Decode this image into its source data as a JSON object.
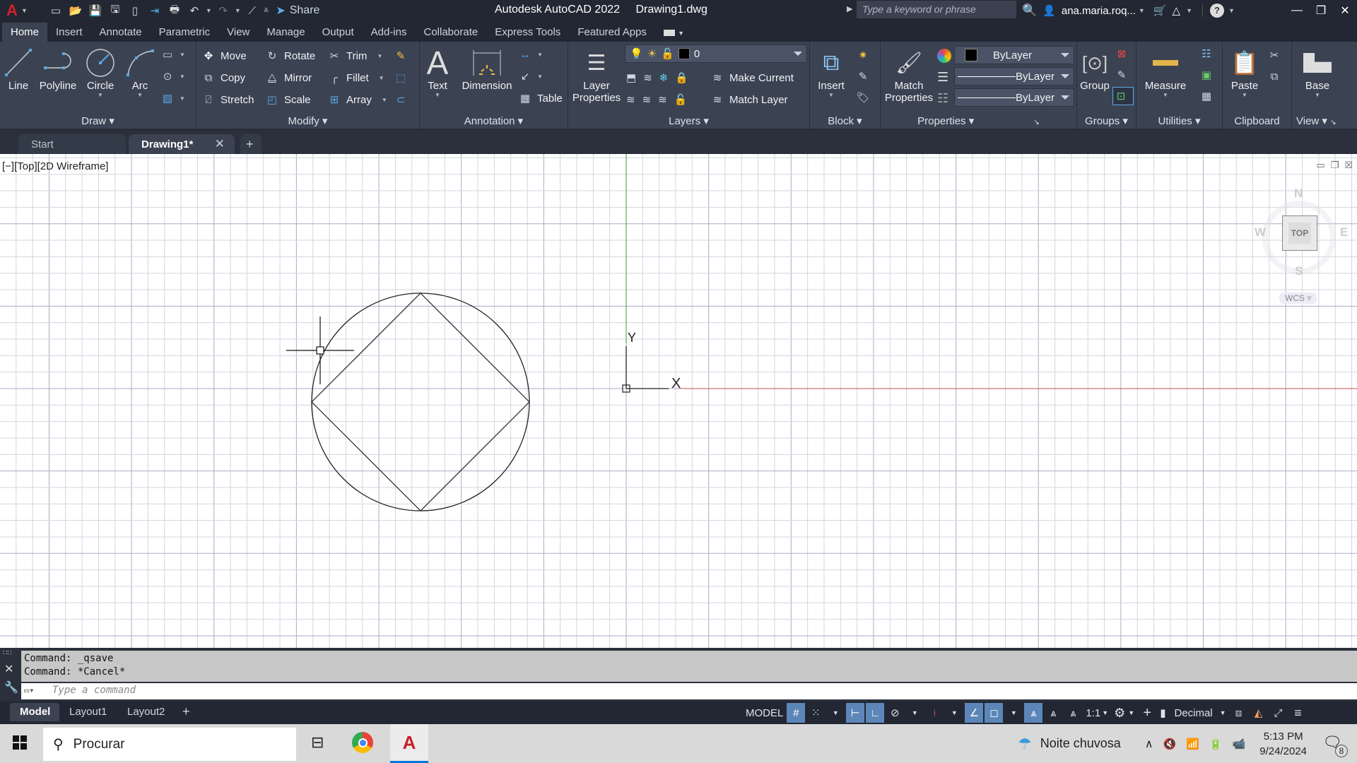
{
  "titlebar": {
    "app_icon": "autocad-logo-icon",
    "quick_access": [
      "new-icon",
      "open-icon",
      "save-icon",
      "save-as-icon",
      "open-web-mobile-icon",
      "save-web-mobile-icon",
      "plot-icon",
      "undo-icon",
      "redo-icon",
      "workspace-line-icon",
      "customize-qat-icon"
    ],
    "share_label": "Share",
    "app_title": "Autodesk AutoCAD 2022",
    "file_name": "Drawing1.dwg",
    "search_placeholder": "Type a keyword or phrase",
    "user_name": "ana.maria.roq...",
    "help_icon": "?"
  },
  "menu_tabs": [
    "Home",
    "Insert",
    "Annotate",
    "Parametric",
    "View",
    "Manage",
    "Output",
    "Add-ins",
    "Collaborate",
    "Express Tools",
    "Featured Apps"
  ],
  "active_menu_tab": "Home",
  "ribbon": {
    "draw": {
      "title": "Draw",
      "line": "Line",
      "polyline": "Polyline",
      "circle": "Circle",
      "arc": "Arc"
    },
    "modify": {
      "title": "Modify",
      "move": "Move",
      "rotate": "Rotate",
      "trim": "Trim",
      "copy": "Copy",
      "mirror": "Mirror",
      "fillet": "Fillet",
      "stretch": "Stretch",
      "scale": "Scale",
      "array": "Array"
    },
    "annotation": {
      "title": "Annotation",
      "text": "Text",
      "dimension": "Dimension",
      "table": "Table"
    },
    "layers": {
      "title": "Layers",
      "layer_properties_1": "Layer",
      "layer_properties_2": "Properties",
      "current_layer": "0",
      "make_current": "Make Current",
      "match_layer": "Match Layer"
    },
    "block": {
      "title": "Block",
      "insert": "Insert"
    },
    "properties": {
      "title": "Properties",
      "match_1": "Match",
      "match_2": "Properties",
      "color": "ByLayer",
      "lineweight": "ByLayer",
      "linetype": "ByLayer"
    },
    "groups": {
      "title": "Groups",
      "group": "Group"
    },
    "utilities": {
      "title": "Utilities",
      "measure": "Measure"
    },
    "clipboard": {
      "title": "Clipboard",
      "paste": "Paste"
    },
    "view": {
      "title": "View",
      "base": "Base"
    }
  },
  "doc_tabs": [
    {
      "label": "Start",
      "active": false
    },
    {
      "label": "Drawing1*",
      "active": true
    }
  ],
  "viewport": {
    "label": "[−][Top][2D Wireframe]",
    "viewcube": {
      "top": "TOP",
      "north": "N",
      "south": "S",
      "east": "E",
      "west": "W",
      "ucs": "WCS"
    },
    "ucs_x": "X",
    "ucs_y": "Y"
  },
  "drawing": {
    "entities": [
      {
        "type": "circle",
        "description": "circle"
      },
      {
        "type": "polygon",
        "sides": 4,
        "description": "square inscribed in circle, rotated 45 degrees"
      }
    ]
  },
  "command": {
    "history": [
      "Command: _qsave",
      "Command: *Cancel*"
    ],
    "input_placeholder": "Type a command"
  },
  "layout_tabs": [
    "Model",
    "Layout1",
    "Layout2"
  ],
  "active_layout": "Model",
  "statusbar": {
    "space": "MODEL",
    "annotation_scale": "1:1",
    "units": "Decimal"
  },
  "taskbar": {
    "search_placeholder": "Procurar",
    "weather": "Noite chuvosa",
    "time": "5:13 PM",
    "date": "9/24/2024",
    "notifications": "8"
  }
}
